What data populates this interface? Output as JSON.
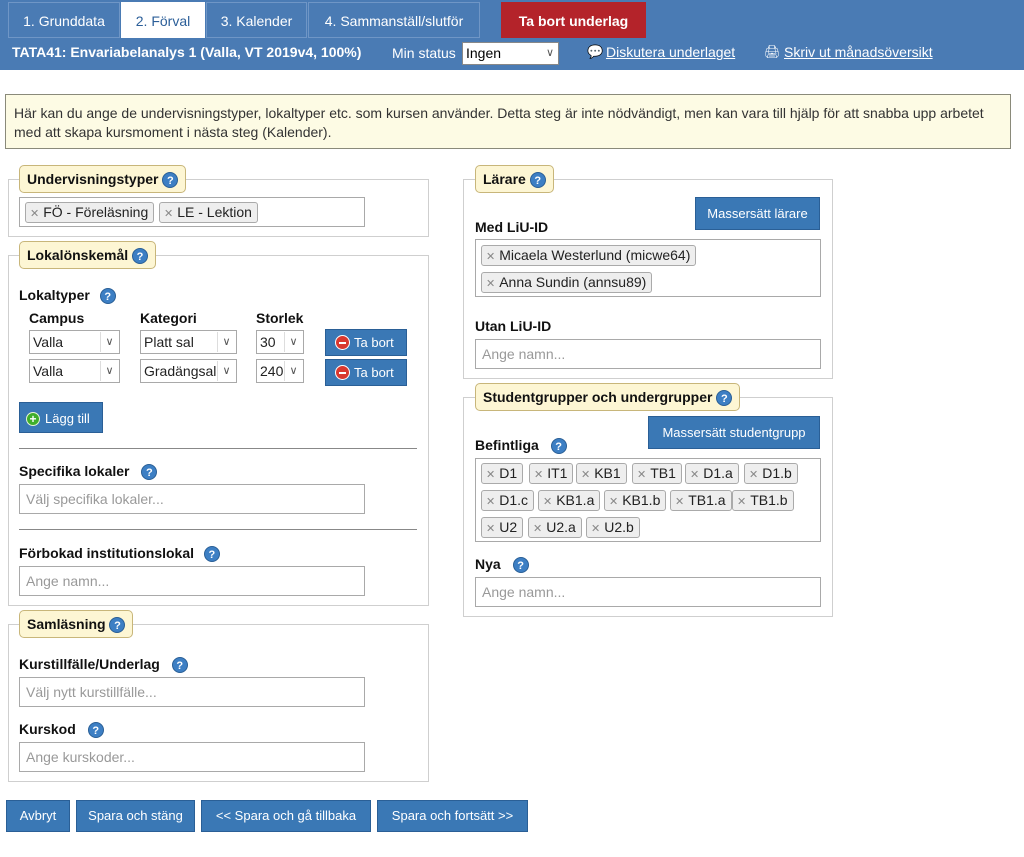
{
  "tabs": [
    {
      "label": "1. Grunddata"
    },
    {
      "label": "2. Förval"
    },
    {
      "label": "3. Kalender"
    },
    {
      "label": "4. Sammanställ/slutför"
    }
  ],
  "delete_tab": "Ta bort underlag",
  "course_title": "TATA41: Envariabelanalys 1 (Valla, VT 2019v4, 100%)",
  "min_status_label": "Min status",
  "min_status_value": "Ingen",
  "discuss_link": "Diskutera underlaget",
  "print_link": "Skriv ut månadsöversikt",
  "info_text": "Här kan du ange de undervisningstyper, lokaltyper etc. som kursen använder. Detta steg är inte nödvändigt, men kan vara till hjälp för att snabba upp arbetet med att skapa kursmoment i nästa steg (Kalender).",
  "help_glyph": "?",
  "teaching": {
    "legend": "Undervisningstyper",
    "tags": [
      "FÖ - Föreläsning",
      "LE - Lektion"
    ]
  },
  "rooms": {
    "legend": "Lokalönskemål",
    "types_label": "Lokaltyper",
    "col_campus": "Campus",
    "col_category": "Kategori",
    "col_size": "Storlek",
    "rows": [
      {
        "campus": "Valla",
        "category": "Platt sal",
        "size": "30",
        "remove": "Ta bort"
      },
      {
        "campus": "Valla",
        "category": "Gradängsal",
        "size": "240",
        "remove": "Ta bort"
      }
    ],
    "add_label": "Lägg till",
    "specific_label": "Specifika lokaler",
    "specific_placeholder": "Välj specifika lokaler...",
    "booked_label": "Förbokad institutionslokal",
    "booked_placeholder": "Ange namn..."
  },
  "colearn": {
    "legend": "Samläsning",
    "instance_label": "Kurstillfälle/Underlag",
    "instance_placeholder": "Välj nytt kurstillfälle...",
    "code_label": "Kurskod",
    "code_placeholder": "Ange kurskoder..."
  },
  "teachers": {
    "legend": "Lärare",
    "mass_button": "Massersätt lärare",
    "with_id_label": "Med LiU-ID",
    "with_id": [
      "Micaela Westerlund (micwe64)",
      "Anna Sundin (annsu89)"
    ],
    "without_id_label": "Utan LiU-ID",
    "without_id_placeholder": "Ange namn..."
  },
  "groups": {
    "legend": "Studentgrupper och undergrupper",
    "mass_button": "Massersätt studentgrupp",
    "existing_label": "Befintliga",
    "existing": [
      "D1",
      "IT1",
      "KB1",
      "TB1",
      "D1.a",
      "D1.b",
      "D1.c",
      "KB1.a",
      "KB1.b",
      "TB1.a",
      "TB1.b",
      "U2",
      "U2.a",
      "U2.b"
    ],
    "new_label": "Nya",
    "new_placeholder": "Ange namn..."
  },
  "footer": {
    "cancel": "Avbryt",
    "save_close": "Spara och stäng",
    "save_back": "<< Spara och gå tillbaka",
    "save_next": "Spara och fortsätt >>"
  }
}
